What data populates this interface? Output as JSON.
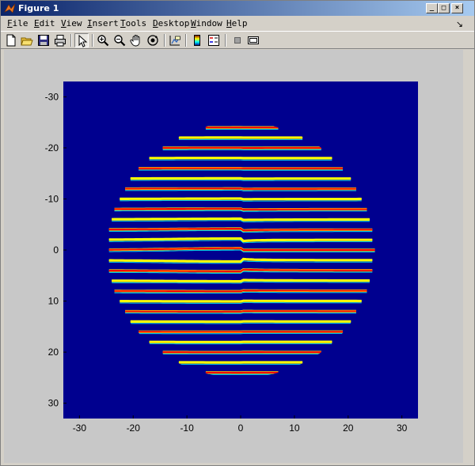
{
  "window": {
    "title": "Figure 1",
    "minimize_label": "_",
    "maximize_label": "□",
    "close_label": "×"
  },
  "menu": [
    {
      "key": "F",
      "rest": "ile"
    },
    {
      "key": "E",
      "rest": "dit"
    },
    {
      "key": "V",
      "rest": "iew"
    },
    {
      "key": "I",
      "rest": "nsert"
    },
    {
      "key": "T",
      "rest": "ools"
    },
    {
      "key": "D",
      "rest": "esktop"
    },
    {
      "key": "W",
      "rest": "indow"
    },
    {
      "key": "H",
      "rest": "elp"
    }
  ],
  "toolbar": {
    "tools": [
      "new-figure",
      "open-file",
      "save",
      "print",
      "edit-plot",
      "zoom-in",
      "zoom-out",
      "pan",
      "rotate-3d",
      "data-cursor",
      "colorbar",
      "legend",
      "hide-plot-tools",
      "show-plot-tools"
    ]
  },
  "chart_data": {
    "type": "heatmap",
    "title": "",
    "xlabel": "",
    "ylabel": "",
    "xlim": [
      -33,
      33
    ],
    "ylim": [
      -33,
      33
    ],
    "y_reversed": true,
    "xticks": [
      -30,
      -20,
      -10,
      0,
      10,
      20,
      30
    ],
    "yticks": [
      -30,
      -20,
      -10,
      0,
      10,
      20,
      30
    ],
    "aperture_radius": 25,
    "fringe_period": 2,
    "fork_dislocation_at": [
      0,
      0
    ],
    "background_color": "#00008f",
    "colormap": "jet",
    "fringe_colors": [
      "#00ffff",
      "#ffff00",
      "#ff0000",
      "#800000",
      "#0000ff"
    ]
  }
}
